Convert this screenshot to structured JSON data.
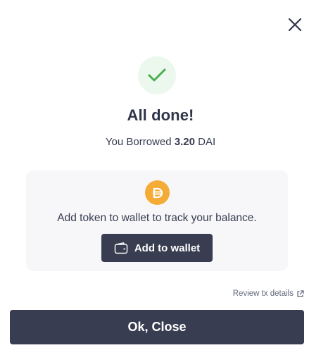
{
  "modal": {
    "title": "All done!",
    "subtitle_prefix": "You Borrowed",
    "amount": "3.20",
    "asset": "DAI"
  },
  "token_card": {
    "message": "Add token to wallet to track your balance.",
    "add_button_label": "Add to wallet",
    "token_icon": "dai-token-icon",
    "wallet_icon": "wallet-icon"
  },
  "review_link": {
    "label": "Review tx details",
    "icon": "external-link-icon"
  },
  "footer": {
    "close_label": "Ok, Close"
  },
  "colors": {
    "primary_dark": "#383d51",
    "success_green": "#4caf50",
    "success_bg": "#ecf8ed",
    "dai_orange": "#f5ac37",
    "card_bg": "#f7f7f9"
  }
}
